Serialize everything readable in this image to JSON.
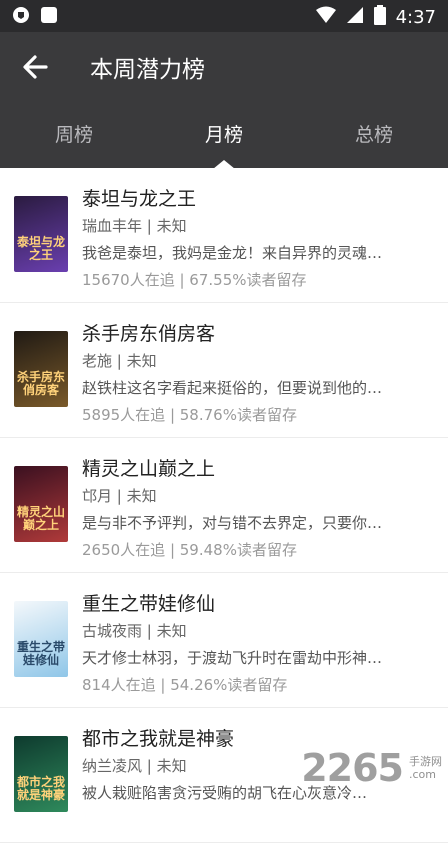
{
  "status_bar": {
    "time": "4:37"
  },
  "header": {
    "title": "本周潜力榜"
  },
  "tabs": [
    {
      "label": "周榜",
      "active": false
    },
    {
      "label": "月榜",
      "active": true
    },
    {
      "label": "总榜",
      "active": false
    }
  ],
  "books": [
    {
      "title": "泰坦与龙之王",
      "author": "瑞血丰年 | 未知",
      "desc": "我爸是泰坦，我妈是金龙！来自异界的灵魂…",
      "stats": "15670人在追 | 67.55%读者留存",
      "cover_text": "泰坦与龙之王",
      "cover_colors": [
        "#2a1b3f",
        "#6a3fb0"
      ]
    },
    {
      "title": "杀手房东俏房客",
      "author": "老施 | 未知",
      "desc": "赵铁柱这名字看起来挺俗的，但要说到他的…",
      "stats": "5895人在追 | 58.76%读者留存",
      "cover_text": "杀手房东俏房客",
      "cover_colors": [
        "#201a14",
        "#7a5a2a"
      ]
    },
    {
      "title": "精灵之山巅之上",
      "author": "邙月 | 未知",
      "desc": "是与非不予评判，对与错不去界定，只要你…",
      "stats": "2650人在追 | 59.48%读者留存",
      "cover_text": "精灵之山巅之上",
      "cover_colors": [
        "#3a1020",
        "#b03a3a"
      ]
    },
    {
      "title": "重生之带娃修仙",
      "author": "古城夜雨 | 未知",
      "desc": "天才修士林羽，于渡劫飞升时在雷劫中形神…",
      "stats": "814人在追 | 54.26%读者留存",
      "cover_text": "重生之带娃修仙",
      "cover_colors": [
        "#f4f8fb",
        "#8fc6e8"
      ]
    },
    {
      "title": "都市之我就是神豪",
      "author": "纳兰凌风 | 未知",
      "desc": "被人栽赃陷害贪污受贿的胡飞在心灰意冷…",
      "stats": "",
      "cover_text": "都市之我就是神豪",
      "cover_colors": [
        "#0e3a2e",
        "#2f8a5c"
      ]
    }
  ],
  "watermark": {
    "number": "2265",
    "cn": "手游网",
    "domain": ".com"
  }
}
